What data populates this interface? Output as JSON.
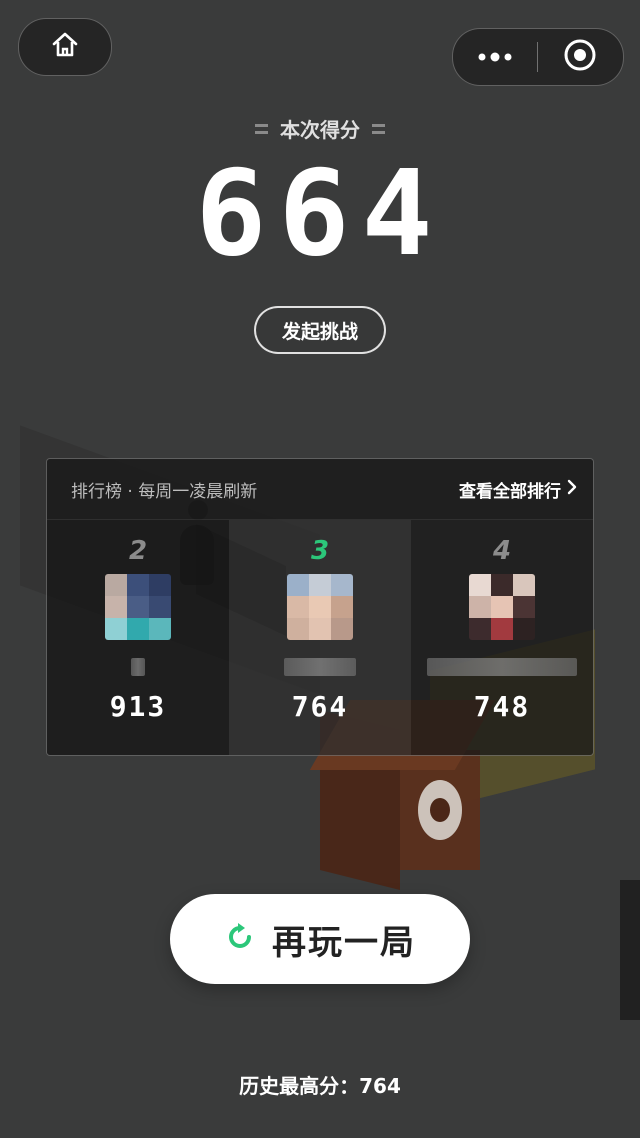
{
  "score": {
    "label": "本次得分",
    "value": "664"
  },
  "challenge_button": "发起挑战",
  "leaderboard": {
    "title": "排行榜 · 每周一凌晨刷新",
    "view_all": "查看全部排行",
    "entries": [
      {
        "rank": "2",
        "score": "913",
        "is_current_user": false
      },
      {
        "rank": "3",
        "score": "764",
        "is_current_user": true
      },
      {
        "rank": "4",
        "score": "748",
        "is_current_user": false
      }
    ]
  },
  "play_again_button": "再玩一局",
  "best_score": "历史最高分：764",
  "colors": {
    "background": "#3a3b3b",
    "accent_green": "#2cc77a",
    "button_white": "#ffffff"
  },
  "icons": {
    "home": "home-icon",
    "more": "more-dots-icon",
    "close": "target-icon",
    "chevron": "chevron-right-icon",
    "replay": "replay-icon"
  }
}
